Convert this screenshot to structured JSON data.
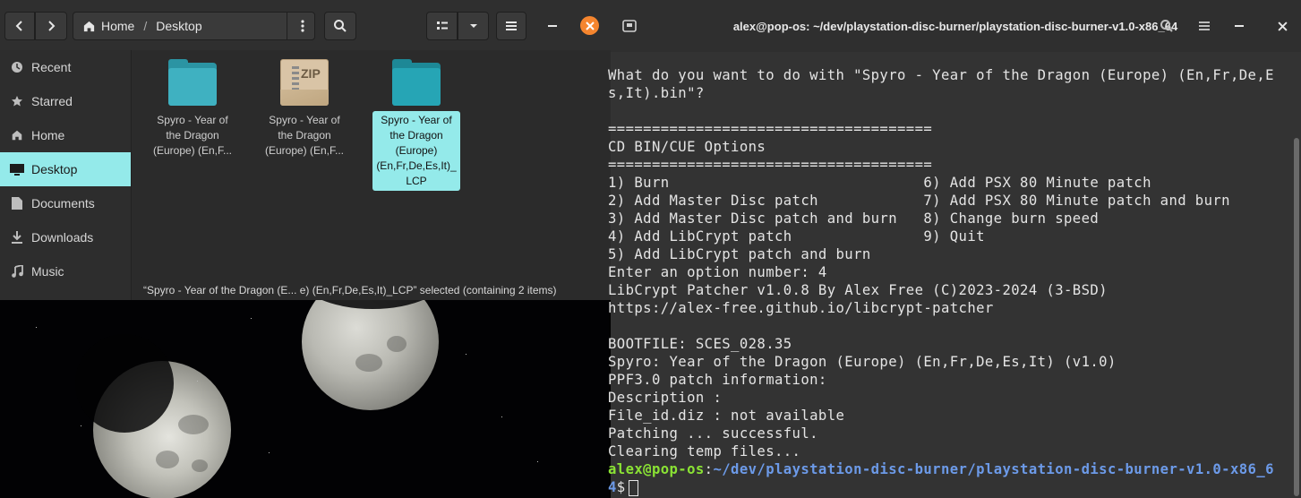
{
  "files": {
    "nav": {
      "back_icon": "chevron-left-icon",
      "forward_icon": "chevron-right-icon"
    },
    "breadcrumb": [
      "Home",
      "/",
      "Desktop"
    ],
    "sidebar": {
      "items": [
        {
          "label": "Recent",
          "icon": "clock-icon"
        },
        {
          "label": "Starred",
          "icon": "star-icon"
        },
        {
          "label": "Home",
          "icon": "home-icon"
        },
        {
          "label": "Desktop",
          "icon": "desktop-icon",
          "active": true
        },
        {
          "label": "Documents",
          "icon": "document-icon"
        },
        {
          "label": "Downloads",
          "icon": "download-icon"
        },
        {
          "label": "Music",
          "icon": "music-icon"
        }
      ]
    },
    "items": [
      {
        "name": "Spyro - Year of the Dragon (Europe) (En,F...",
        "type": "folder",
        "color": "#3fb1c1"
      },
      {
        "name": "Spyro - Year of the Dragon (Europe) (En,F...",
        "type": "zip",
        "badge": "ZIP"
      },
      {
        "name": "Spyro - Year of the Dragon (Europe) (En,Fr,De,Es,It)_ LCP",
        "type": "folder",
        "color": "#26a5b5",
        "selected": true
      }
    ],
    "status": "“Spyro - Year of the Dragon (E...  e) (En,Fr,De,Es,It)_LCP” selected  (containing 2 items)"
  },
  "terminal": {
    "title": "alex@pop-os: ~/dev/playstation-disc-burner/playstation-disc-burner-v1.0-x86_64",
    "lines": [
      "What do you want to do with \"Spyro - Year of the Dragon (Europe) (En,Fr,De,E",
      "s,It).bin\"?",
      "",
      "=====================================",
      "CD BIN/CUE Options",
      "=====================================",
      "1) Burn                             6) Add PSX 80 Minute patch",
      "2) Add Master Disc patch            7) Add PSX 80 Minute patch and burn",
      "3) Add Master Disc patch and burn   8) Change burn speed",
      "4) Add LibCrypt patch               9) Quit",
      "5) Add LibCrypt patch and burn",
      "Enter an option number: 4",
      "LibCrypt Patcher v1.0.8 By Alex Free (C)2023-2024 (3-BSD)",
      "https://alex-free.github.io/libcrypt-patcher",
      "",
      "BOOTFILE: SCES_028.35",
      "Spyro: Year of the Dragon (Europe) (En,Fr,De,Es,It) (v1.0)",
      "PPF3.0 patch information:",
      "Description :",
      "File_id.diz : not available",
      "Patching ... successful.",
      "Clearing temp files..."
    ],
    "prompt_user": "alex@pop-os",
    "prompt_sep": ":",
    "prompt_path": "~/dev/playstation-disc-burner/playstation-disc-burner-v1.0-x86_6",
    "prompt_path_wrap": "4",
    "prompt_symbol": "$"
  },
  "colors": {
    "accent": "#94eaea",
    "close_button": "#f5852e",
    "prompt_user": "#8ae234",
    "prompt_path": "#6c9ae8"
  }
}
